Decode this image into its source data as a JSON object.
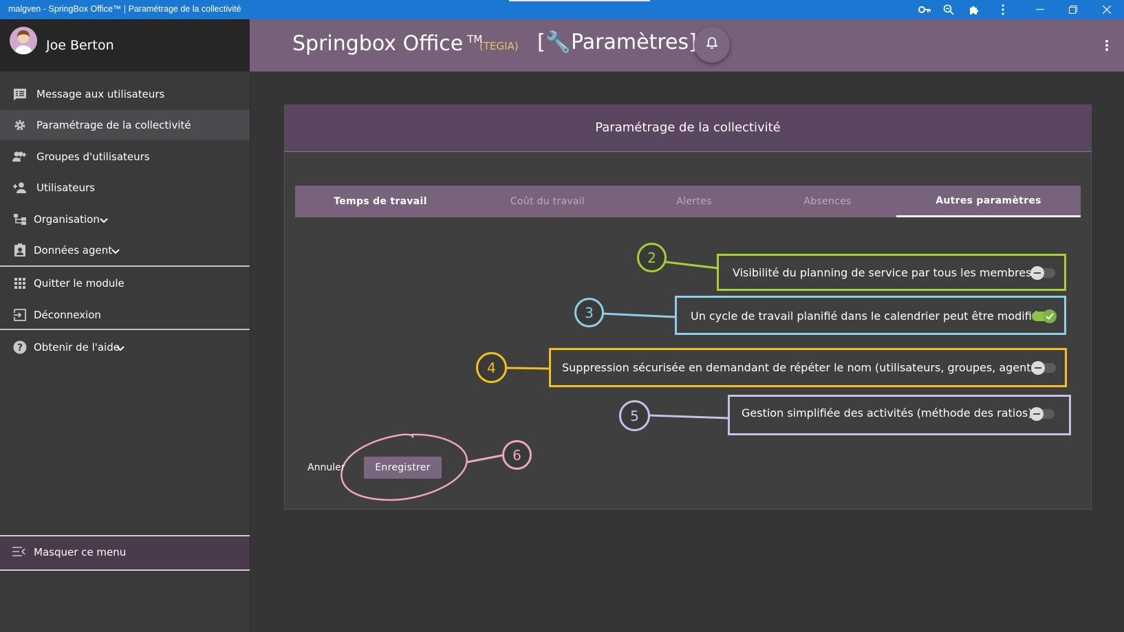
{
  "window": {
    "title": "malgven - SpringBox Office™ | Paramétrage de la collectivité",
    "controls": [
      "key-icon",
      "zoom-icon",
      "puzzle-icon",
      "more-vertical-icon",
      "minimize-icon",
      "restore-icon",
      "close-icon"
    ]
  },
  "user": {
    "name": "Joe Berton"
  },
  "sidebar": {
    "items": [
      {
        "label": "Message aux utilisateurs",
        "icon": "message-list-icon"
      },
      {
        "label": "Paramétrage de la collectivité",
        "icon": "gear-icon",
        "active": true
      },
      {
        "label": "Groupes d'utilisateurs",
        "icon": "group-add-icon"
      },
      {
        "label": "Utilisateurs",
        "icon": "person-add-icon"
      },
      {
        "label": "Organisation",
        "icon": "org-chart-icon",
        "expandable": true
      },
      {
        "label": "Données agent",
        "icon": "badge-icon",
        "expandable": true
      },
      {
        "label": "Quitter le module",
        "icon": "apps-grid-icon"
      },
      {
        "label": "Déconnexion",
        "icon": "logout-icon"
      },
      {
        "label": "Obtenir de l'aide",
        "icon": "help-icon",
        "expandable": true
      }
    ],
    "hide_menu_label": "Masquer ce menu"
  },
  "header": {
    "app_title": "Springbox Office",
    "trademark": "TM",
    "org_code": "(TEGIA)",
    "section": "[🔧Paramètres]"
  },
  "card": {
    "title": "Paramétrage de la collectivité",
    "tabs": [
      {
        "label": "Temps de travail",
        "state": "enabled"
      },
      {
        "label": "Coût du travail",
        "state": "dim"
      },
      {
        "label": "Alertes",
        "state": "dim"
      },
      {
        "label": "Absences",
        "state": "dim"
      },
      {
        "label": "Autres paramètres",
        "state": "selected"
      }
    ],
    "options": [
      {
        "num": "2",
        "label": "Visibilité du planning de service par tous les membres",
        "enabled": false,
        "color": "#a6d234"
      },
      {
        "num": "3",
        "label": "Un cycle de travail planifié dans le calendrier peut être modifié",
        "enabled": true,
        "color": "#8fd0e8"
      },
      {
        "num": "4",
        "label": "Suppression sécurisée en demandant de répéter le nom (utilisateurs, groupes, agents)",
        "enabled": false,
        "color": "#f2c21b"
      },
      {
        "num": "5",
        "label": "Gestion simplifiée des activités (méthode des ratios)",
        "enabled": false,
        "color": "#c8c0e8"
      }
    ],
    "cancel_label": "Annuler",
    "save_label": "Enregistrer",
    "save_callout": {
      "num": "6",
      "color": "#f0a6c0"
    }
  }
}
